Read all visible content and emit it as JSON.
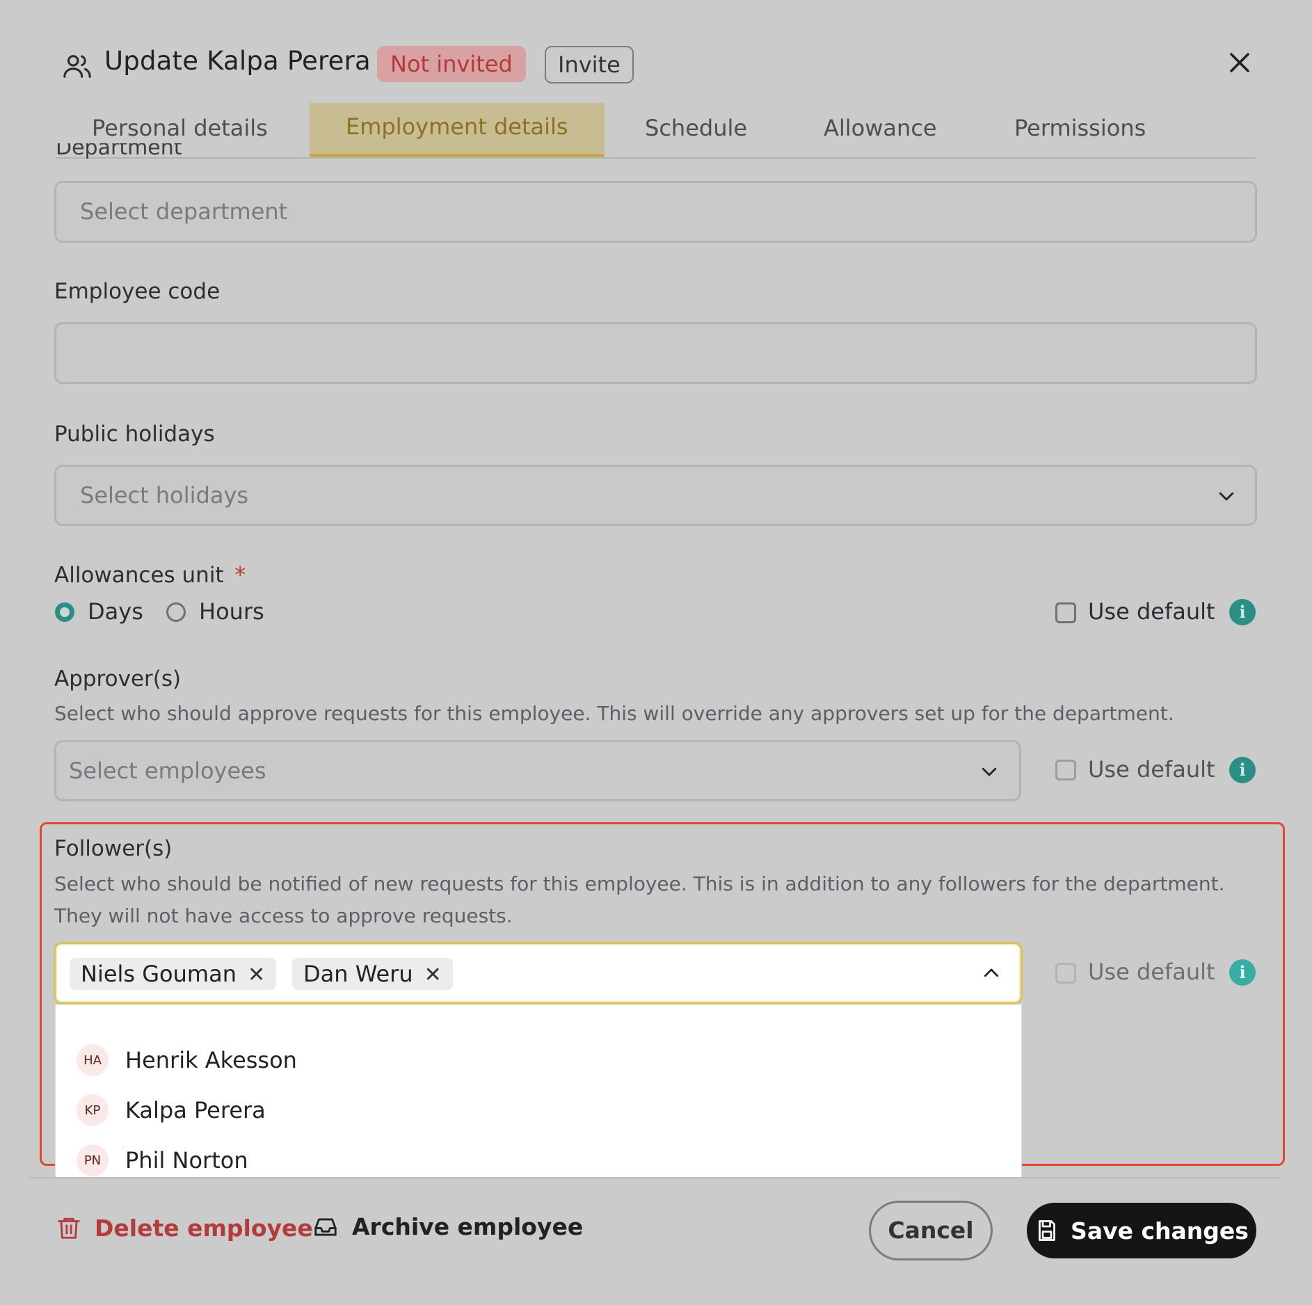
{
  "header": {
    "icon": "users-icon",
    "title": "Update Kalpa Perera",
    "status_badge": "Not invited",
    "invite_label": "Invite",
    "close_icon": "close-icon"
  },
  "tabs": [
    {
      "label": "Personal details",
      "active": false
    },
    {
      "label": "Employment details",
      "active": true
    },
    {
      "label": "Schedule",
      "active": false
    },
    {
      "label": "Allowance",
      "active": false
    },
    {
      "label": "Permissions",
      "active": false
    }
  ],
  "department": {
    "label": "Department",
    "placeholder": "Select department"
  },
  "employee_code": {
    "label": "Employee code",
    "value": ""
  },
  "public_holidays": {
    "label": "Public holidays",
    "placeholder": "Select holidays"
  },
  "allowances_unit": {
    "label": "Allowances unit",
    "required_mark": "*",
    "options": [
      {
        "label": "Days",
        "selected": true
      },
      {
        "label": "Hours",
        "selected": false
      }
    ],
    "use_default_label": "Use default"
  },
  "approvers": {
    "label": "Approver(s)",
    "description": "Select who should approve requests for this employee. This will override any approvers set up for the department.",
    "placeholder": "Select employees",
    "use_default_label": "Use default"
  },
  "followers": {
    "label": "Follower(s)",
    "description_line1": "Select who should be notified of new requests for this employee. This is in addition to any followers for the department.",
    "description_line2": "They will not have access to approve requests.",
    "selected": [
      "Niels Gouman",
      "Dan Weru"
    ],
    "use_default_label": "Use default",
    "options": [
      {
        "initials": "HA",
        "name": "Henrik Akesson"
      },
      {
        "initials": "KP",
        "name": "Kalpa Perera"
      },
      {
        "initials": "PN",
        "name": "Phil Norton"
      }
    ]
  },
  "footer": {
    "delete_label": "Delete employee",
    "archive_label": "Archive employee",
    "cancel_label": "Cancel",
    "save_label": "Save changes"
  },
  "colors": {
    "accent_tab": "#c6a748",
    "radio_selected": "#2b8f86",
    "danger": "#b43b3b",
    "highlight": "#e04a2c",
    "primary_button": "#151515"
  }
}
